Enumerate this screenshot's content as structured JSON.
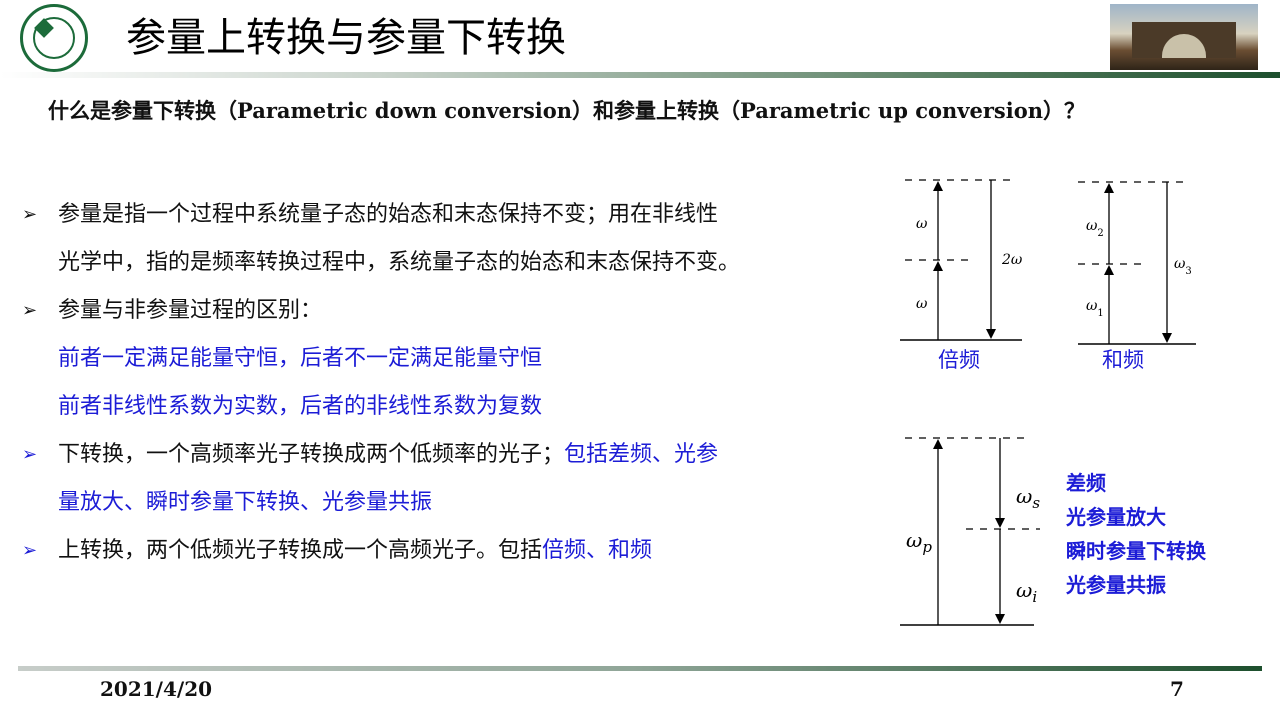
{
  "header": {
    "title": "参量上转换与参量下转换",
    "logo_icon": "sysu-emblem-icon",
    "photo_icon": "campus-gate-photo"
  },
  "question": "什么是参量下转换（Parametric down conversion）和参量上转换（Parametric up conversion）？",
  "bullets": {
    "b1_line1": "参量是指一个过程中系统量子态的始态和末态保持不变；用在非线性",
    "b1_line2": "光学中，指的是频率转换过程中，系统量子态的始态和末态保持不变。",
    "b2_line1": "参量与非参量过程的区别：",
    "b2_sub1": "前者一定满足能量守恒，后者不一定满足能量守恒",
    "b2_sub2": "前者非线性系数为实数，后者的非线性系数为复数",
    "b3_line1_black": "下转换，一个高频率光子转换成两个低频率的光子；",
    "b3_line1_blue": "包括差频、光参",
    "b3_line2_blue": "量放大、瞬时参量下转换、光参量共振",
    "b4_black": "上转换，两个低频光子转换成一个高频光子。包括",
    "b4_blue": "倍频、和频"
  },
  "diagram": {
    "shg": {
      "label": "倍频",
      "w_lower": "ω",
      "w_upper": "ω",
      "w_total": "2ω"
    },
    "sfg": {
      "label": "和频",
      "w1": "ω",
      "w1_sub": "1",
      "w2": "ω",
      "w2_sub": "2",
      "w3": "ω",
      "w3_sub": "3"
    },
    "pdc": {
      "wp": "ω",
      "wp_sub": "p",
      "ws": "ω",
      "ws_sub": "s",
      "wi": "ω",
      "wi_sub": "i",
      "labels": [
        "差频",
        "光参量放大",
        "瞬时参量下转换",
        "光参量共振"
      ]
    }
  },
  "colors": {
    "blue": "#1c1cd6",
    "green": "#1d4f2d"
  },
  "footer": {
    "date": "2021/4/20",
    "page": "7"
  }
}
